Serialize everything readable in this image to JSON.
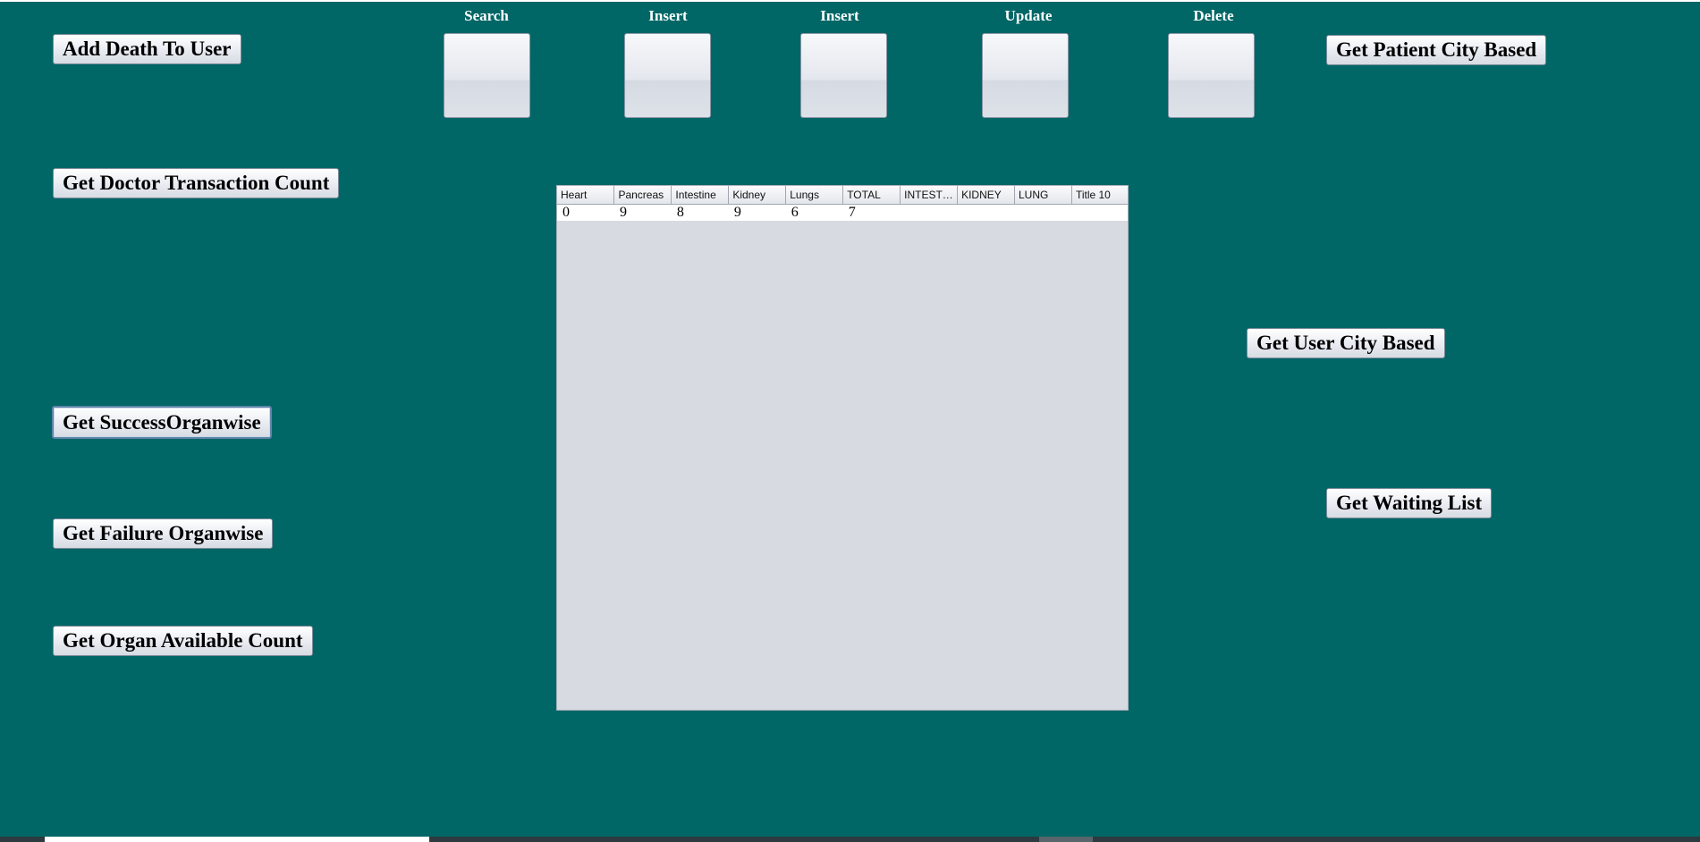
{
  "left_buttons": {
    "add_death": "Add Death To User",
    "doctor_transaction": "Get Doctor Transaction Count",
    "success_organwise": "Get SuccessOrganwise",
    "failure_organwise": "Get Failure Organwise",
    "organ_available": "Get Organ Available Count"
  },
  "top_actions": {
    "search": "Search",
    "insert_1": "Insert",
    "insert_2": "Insert",
    "update": "Update",
    "delete": "Delete"
  },
  "right_buttons": {
    "patient_city": "Get Patient City Based",
    "user_city": "Get User City Based",
    "waiting_list": "Get Waiting List"
  },
  "table": {
    "columns": [
      "Heart",
      "Pancreas",
      "Intestine",
      "Kidney",
      "Lungs",
      "TOTAL",
      "INTESTI...",
      "KIDNEY",
      "LUNG",
      "Title 10"
    ],
    "rows": [
      [
        "0",
        "9",
        "8",
        "9",
        "6",
        "7",
        "",
        "",
        "",
        ""
      ]
    ]
  },
  "colors": {
    "background": "#016666",
    "table_bg": "#d8dae2"
  }
}
